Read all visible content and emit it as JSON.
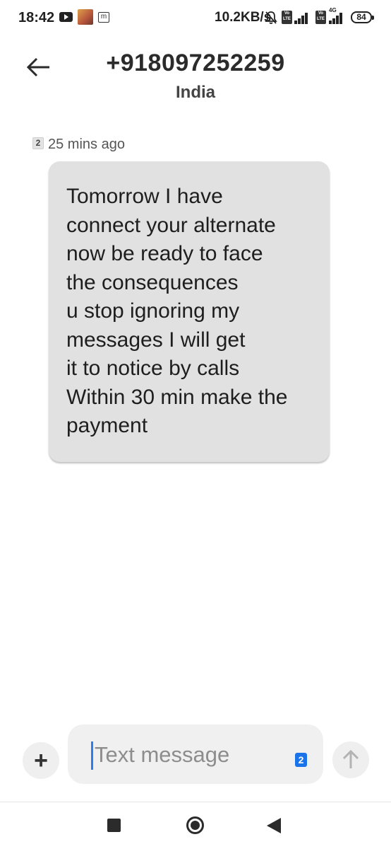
{
  "status_bar": {
    "time": "18:42",
    "net_speed": "10.2KB/s",
    "volte1": "Vo LTE",
    "volte2": "Vo LTE",
    "network_type": "4G",
    "battery": "84"
  },
  "header": {
    "title": "+918097252259",
    "subtitle": "India",
    "back_icon": "arrow-left-icon"
  },
  "message": {
    "sim_badge": "2",
    "timestamp": "25 mins ago",
    "lines": [
      "Tomorrow I have",
      "connect your alternate",
      "now be ready to face",
      "the consequences",
      "u stop ignoring my",
      "messages I will get",
      "it to notice by calls",
      "Within 30 min make the",
      "payment"
    ]
  },
  "compose": {
    "add_icon": "plus-icon",
    "add_label": "+",
    "placeholder": "Text message",
    "sim_indicator": "2",
    "send_icon": "arrow-up-icon"
  },
  "navigation": {
    "recents_icon": "square-icon",
    "home_icon": "circle-icon",
    "back_icon": "triangle-back-icon"
  }
}
